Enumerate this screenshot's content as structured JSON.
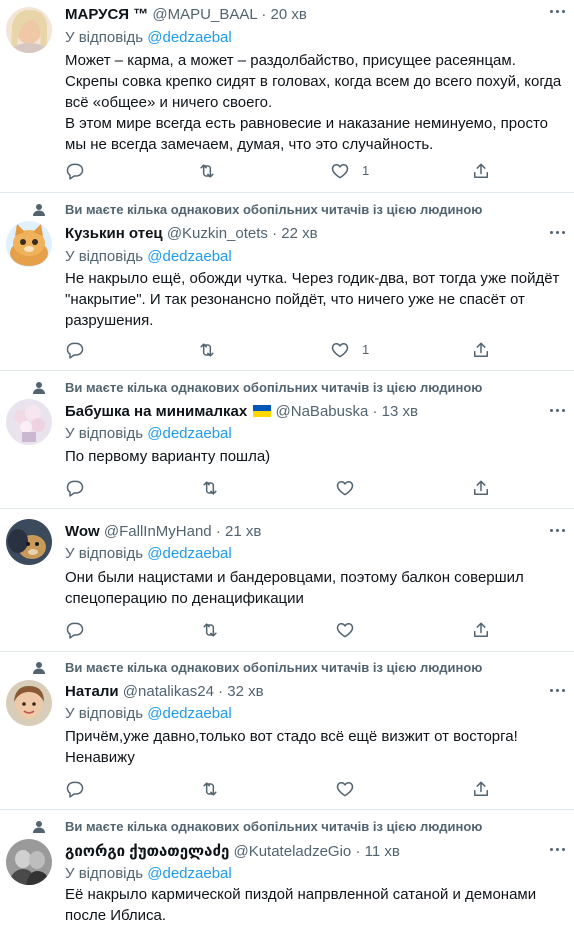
{
  "reply_prefix": "У відповідь",
  "social_context": "Ви маєте кілька однакових обопільних читачів із цією людиною",
  "tweets": [
    {
      "name": "МАРУСЯ ™",
      "handle": "@MAPU_BAAL",
      "time": "20 хв",
      "reply_to": "@dedzaebal",
      "lines": [
        "Может – карма, а может – раздолбайство, присущее расеянцам.",
        "Скрепы совка крепко сидят в головах, когда всем до всего похуй, когда",
        "всё «общее» и ничего своего.",
        "В этом мире всегда есть равновесие и наказание неминуемо, просто",
        "мы не всегда замечаем, думая, что это случайность."
      ],
      "likes": "1"
    },
    {
      "name": "Кузькин отец",
      "handle": "@Kuzkin_otets",
      "time": "22 хв",
      "reply_to": "@dedzaebal",
      "lines": [
        "Не накрыло ещё, обожди чутка. Через годик-два, вот тогда уже пойдёт",
        "\"накрытие\". И так резонансно пойдёт, что ничего уже не спасёт от",
        "разрушения."
      ],
      "likes": "1"
    },
    {
      "name": "Бабушка на минималках",
      "handle": "@NaBabuska",
      "time": "13 хв",
      "reply_to": "@dedzaebal",
      "lines": [
        "По первому варианту пошла)"
      ],
      "likes": ""
    },
    {
      "name": "Wow",
      "handle": "@FallInMyHand",
      "time": "21 хв",
      "reply_to": "@dedzaebal",
      "lines": [
        "Они были нацистами и бандеровцами, поэтому балкон совершил",
        "спецоперацию по денацификации"
      ],
      "likes": ""
    },
    {
      "name": "Натали",
      "handle": "@natalikas24",
      "time": "32 хв",
      "reply_to": "@dedzaebal",
      "lines": [
        "Причём,уже давно,только вот стадо всё ещё визжит от восторга!",
        "Ненавижу"
      ],
      "likes": ""
    },
    {
      "name": "გიორგი ქუთათელაძე",
      "handle": "@KutateladzeGio",
      "time": "11 хв",
      "reply_to": "@dedzaebal",
      "lines": [
        "Её накрыло кармической пиздой напрвленной сатаной и демонами",
        "после Иблиса."
      ],
      "likes": ""
    }
  ],
  "colors": {
    "text": "#0f1419",
    "secondary": "#536471",
    "link": "#1d9bf0",
    "divider": "#e1e8ed"
  },
  "icons": [
    "reply-icon",
    "retweet-icon",
    "like-icon",
    "share-icon",
    "more-icon",
    "person-icon"
  ]
}
